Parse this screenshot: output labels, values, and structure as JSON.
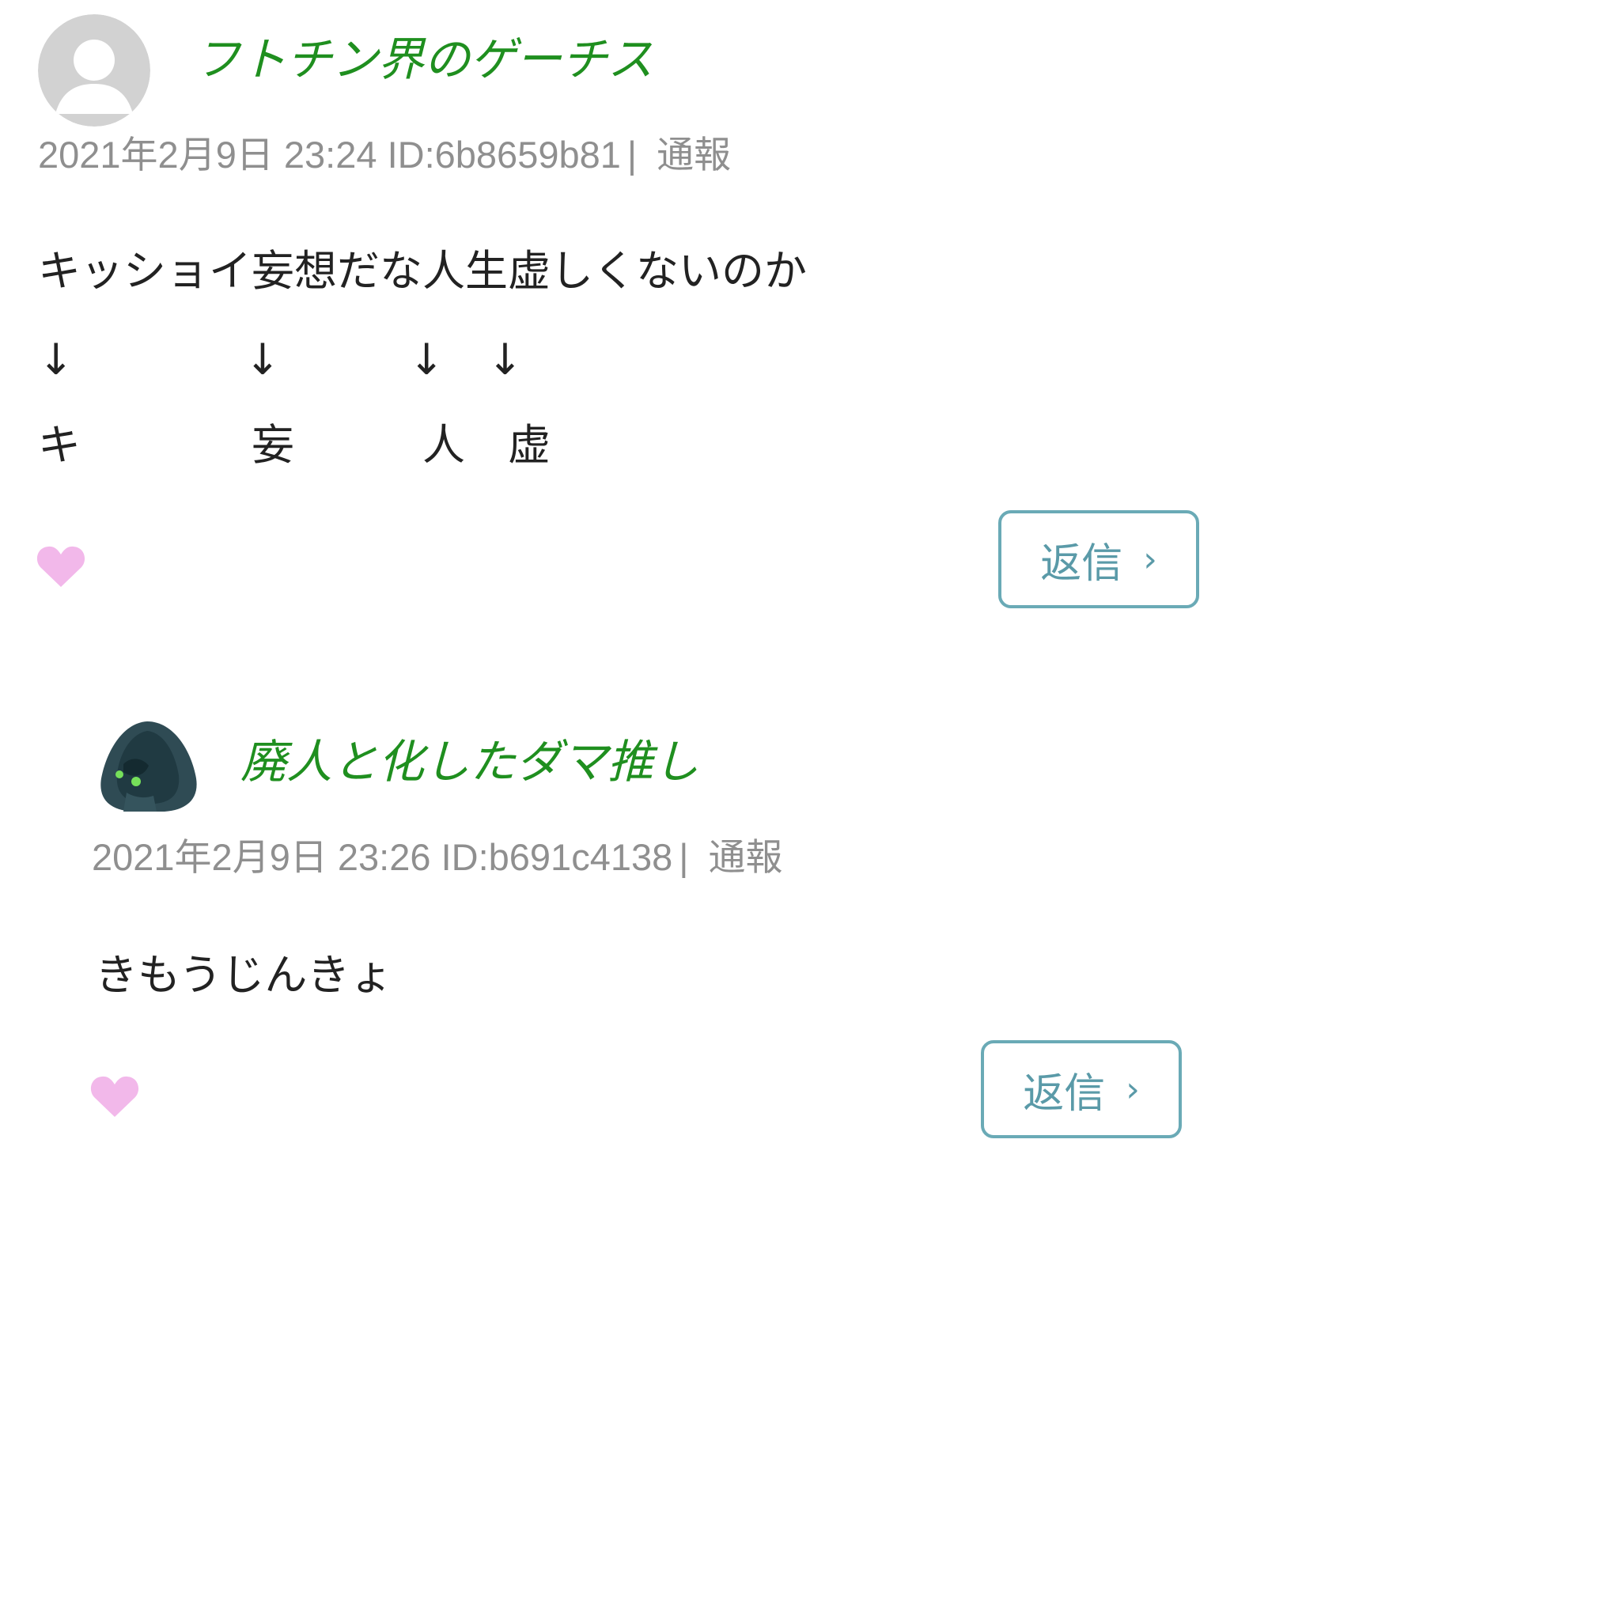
{
  "comments": [
    {
      "author": "フトチン界のゲーチス",
      "datetime": "2021年2月9日 23:24",
      "id": "ID:6b8659b81",
      "separator": "|",
      "report": "通報",
      "body_lines": [
        "キッショイ妄想だな人生虚しくないのか",
        "↓　　　　↓　　　↓　↓",
        "キ　　　　妄　　　人　虚"
      ],
      "reply_label": "返信",
      "reply_chevron": "›"
    },
    {
      "author": "廃人と化したダマ推し",
      "datetime": "2021年2月9日 23:26",
      "id": "ID:b691c4138",
      "separator": "|",
      "report": "通報",
      "body_lines": [
        "きもうじんきょ"
      ],
      "reply_label": "返信",
      "reply_chevron": "›"
    }
  ],
  "colors": {
    "author": "#1f8f1f",
    "meta": "#8f8f8f",
    "heart": "#f2b8ea",
    "reply_border": "#6aaab6",
    "reply_text": "#5a9aa8"
  },
  "icons": {
    "avatar_default": "default-user-avatar",
    "avatar_custom": "hooded-figure-avatar",
    "like": "heart-icon"
  }
}
